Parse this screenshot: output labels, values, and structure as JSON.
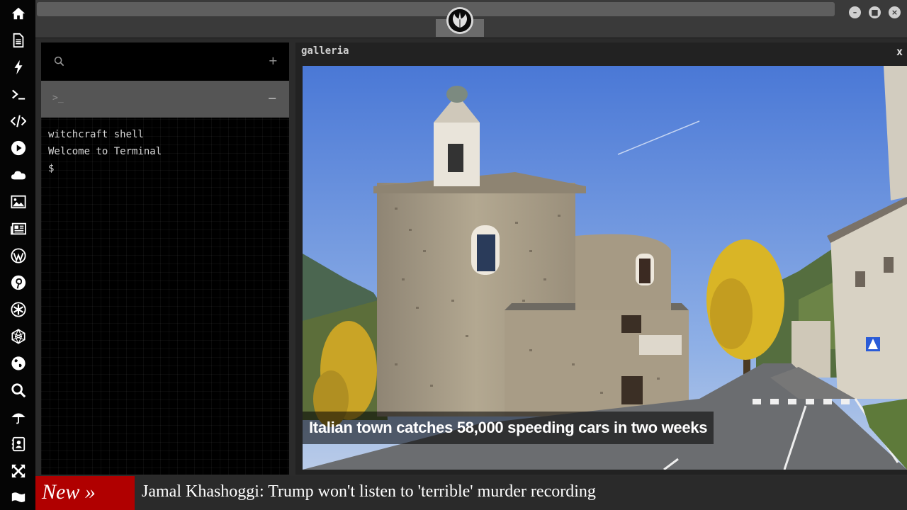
{
  "dock": {
    "items": [
      {
        "icon": "home-icon"
      },
      {
        "icon": "document-icon"
      },
      {
        "icon": "lightning-icon"
      },
      {
        "icon": "terminal-icon"
      },
      {
        "icon": "code-icon"
      },
      {
        "icon": "play-icon"
      },
      {
        "icon": "cloud-icon"
      },
      {
        "icon": "image-icon"
      },
      {
        "icon": "newspaper-icon"
      },
      {
        "icon": "wordpress-icon"
      },
      {
        "icon": "pinterest-icon"
      },
      {
        "icon": "asterisk-icon"
      },
      {
        "icon": "geodesic-icon"
      },
      {
        "icon": "globe-icon"
      },
      {
        "icon": "search-icon"
      },
      {
        "icon": "umbrella-icon"
      },
      {
        "icon": "contact-book-icon"
      },
      {
        "icon": "expand-icon"
      },
      {
        "icon": "flag-icon"
      }
    ]
  },
  "topbar": {
    "logo_icon": "rebel-alliance-icon",
    "window_buttons": [
      "minimize",
      "maximize",
      "close"
    ]
  },
  "terminal": {
    "search_placeholder": "",
    "add_label": "+",
    "tab_prompt": ">_",
    "collapse_label": "−",
    "lines": [
      "witchcraft shell",
      "Welcome to Terminal",
      "$"
    ]
  },
  "gallery": {
    "title": "galleria",
    "close_label": "x",
    "caption": "Italian town catches 58,000 speeding cars in two weeks"
  },
  "ticker": {
    "badge": "New »",
    "headline": "Jamal Khashoggi: Trump won't listen to 'terrible' murder recording"
  },
  "colors": {
    "ticker_badge": "#b00000",
    "panel_bg": "#000000",
    "chrome_bg": "#3a3a3a",
    "dock_bg": "#050505"
  }
}
